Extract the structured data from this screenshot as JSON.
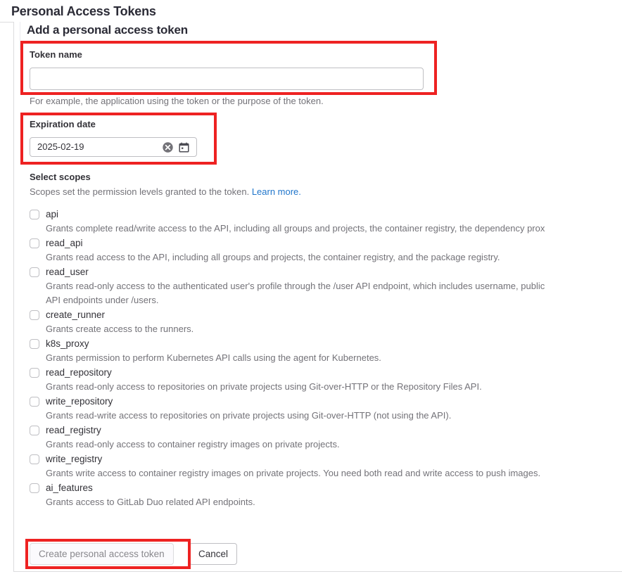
{
  "page": {
    "title": "Personal Access Tokens"
  },
  "card": {
    "heading": "Add a personal access token"
  },
  "token_name": {
    "label": "Token name",
    "value": "",
    "placeholder": "",
    "help": "For example, the application using the token or the purpose of the token."
  },
  "expiration": {
    "label": "Expiration date",
    "value": "2025-02-19",
    "clear_icon": "clear-circle-icon",
    "calendar_icon": "calendar-icon"
  },
  "scopes": {
    "title": "Select scopes",
    "description": "Scopes set the permission levels granted to the token.",
    "learn_more": "Learn more.",
    "items": [
      {
        "name": "api",
        "checked": false,
        "description": "Grants complete read/write access to the API, including all groups and projects, the container registry, the dependency prox"
      },
      {
        "name": "read_api",
        "checked": false,
        "description": "Grants read access to the API, including all groups and projects, the container registry, and the package registry."
      },
      {
        "name": "read_user",
        "checked": false,
        "description": "Grants read-only access to the authenticated user's profile through the /user API endpoint, which includes username, public\nAPI endpoints under /users."
      },
      {
        "name": "create_runner",
        "checked": false,
        "description": "Grants create access to the runners."
      },
      {
        "name": "k8s_proxy",
        "checked": false,
        "description": "Grants permission to perform Kubernetes API calls using the agent for Kubernetes."
      },
      {
        "name": "read_repository",
        "checked": false,
        "description": "Grants read-only access to repositories on private projects using Git-over-HTTP or the Repository Files API."
      },
      {
        "name": "write_repository",
        "checked": false,
        "description": "Grants read-write access to repositories on private projects using Git-over-HTTP (not using the API)."
      },
      {
        "name": "read_registry",
        "checked": false,
        "description": "Grants read-only access to container registry images on private projects."
      },
      {
        "name": "write_registry",
        "checked": false,
        "description": "Grants write access to container registry images on private projects. You need both read and write access to push images."
      },
      {
        "name": "ai_features",
        "checked": false,
        "description": "Grants access to GitLab Duo related API endpoints."
      }
    ]
  },
  "actions": {
    "create_label": "Create personal access token",
    "create_disabled": true,
    "cancel_label": "Cancel"
  },
  "colors": {
    "link": "#1f75cb",
    "annotation": "#ee2222",
    "text": "#333238",
    "muted": "#737278",
    "border": "#bfbfc3"
  }
}
